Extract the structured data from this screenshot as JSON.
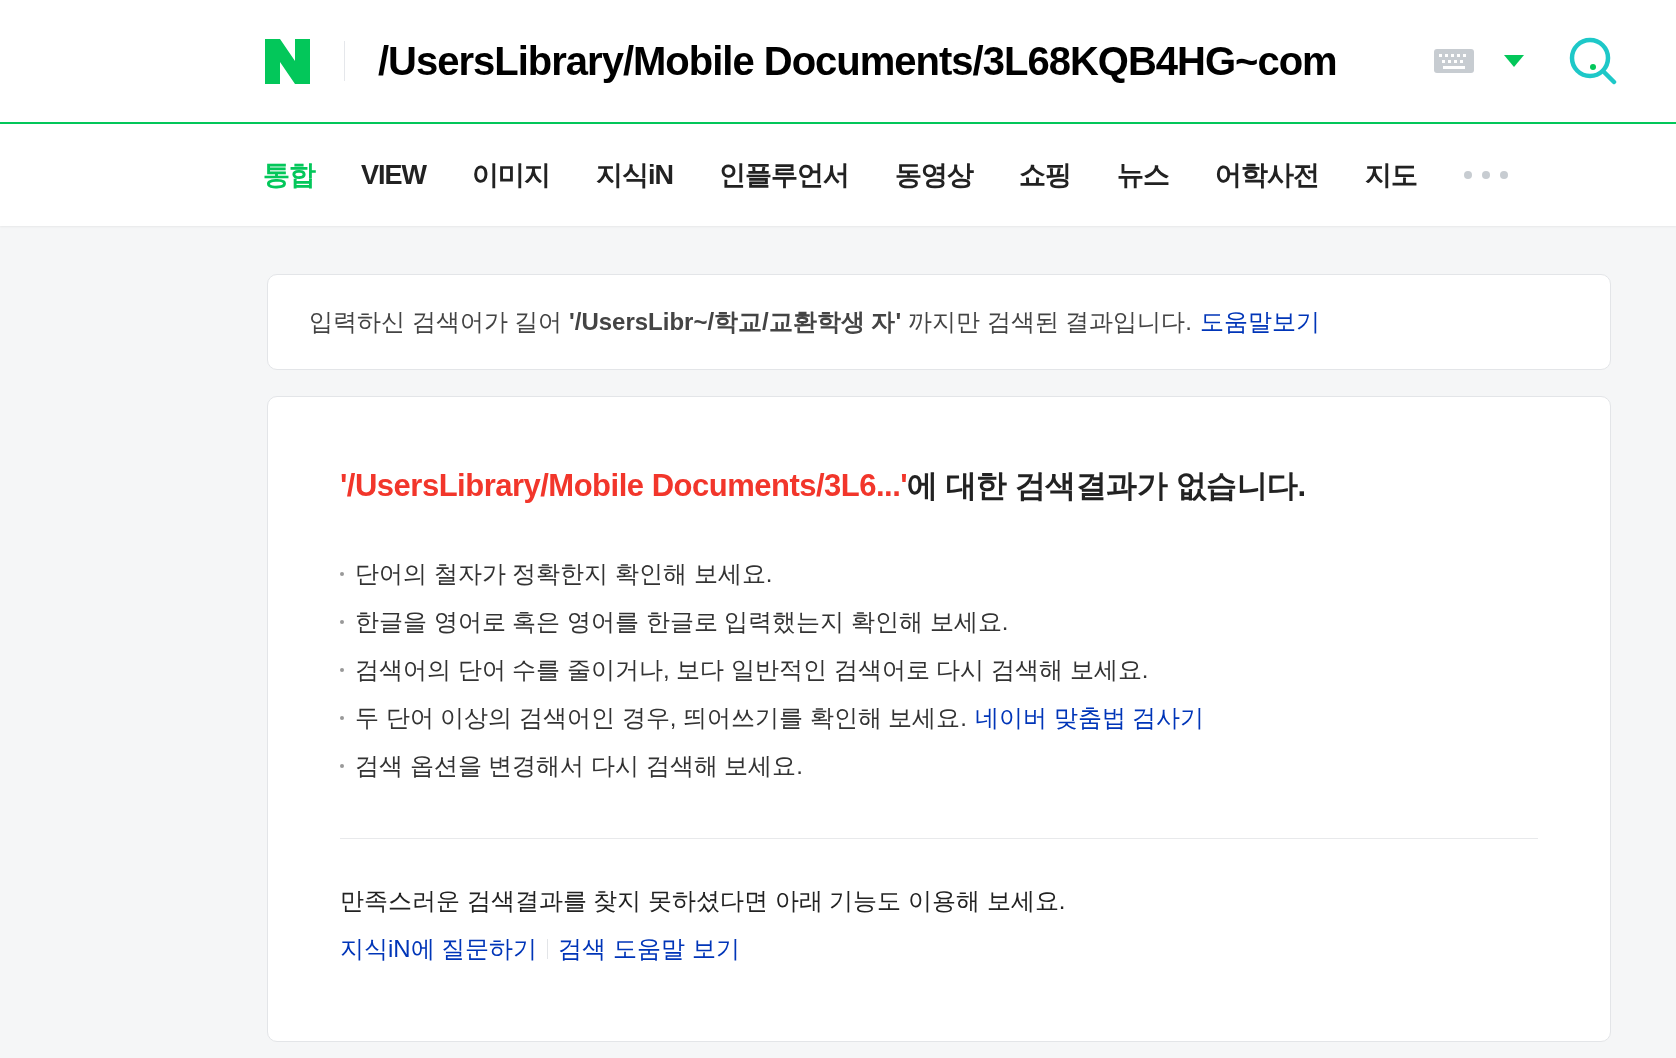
{
  "header": {
    "query": "/UsersLibrary/Mobile Documents/3L68KQB4HG~com"
  },
  "tabs": [
    {
      "label": "통합",
      "selected": true
    },
    {
      "label": "VIEW",
      "selected": false
    },
    {
      "label": "이미지",
      "selected": false
    },
    {
      "label": "지식iN",
      "selected": false
    },
    {
      "label": "인플루언서",
      "selected": false
    },
    {
      "label": "동영상",
      "selected": false
    },
    {
      "label": "쇼핑",
      "selected": false
    },
    {
      "label": "뉴스",
      "selected": false
    },
    {
      "label": "어학사전",
      "selected": false
    },
    {
      "label": "지도",
      "selected": false
    }
  ],
  "notice": {
    "text": "입력하신 검색어가 길어 **'/UsersLibr~/학교/교환학생 자'** 까지만 검색된 결과입니다.",
    "link": "도움말보기"
  },
  "result": {
    "query": "'/UsersLibrary/Mobile Documents/3L6...'",
    "heading": "에 대한 검색결과가 없습니다.",
    "tips": [
      {
        "text": "단어의 철자가 정확한지 확인해 보세요."
      },
      {
        "text": "한글을 영어로 혹은 영어를 한글로 입력했는지 확인해 보세요."
      },
      {
        "text": "검색어의 단어 수를 줄이거나, 보다 일반적인 검색어로 다시 검색해 보세요."
      },
      {
        "text": "두 단어 이상의 검색어인 경우, 띄어쓰기를 확인해 보세요.",
        "link": "네이버 맞춤법 검사기"
      },
      {
        "text": "검색 옵션을 변경해서 다시 검색해 보세요."
      }
    ],
    "footer_text": "만족스러운 검색결과를 찾지 못하셨다면 아래 기능도 이용해 보세요.",
    "footer_links": [
      "지식iN에 질문하기",
      "검색 도움말 보기"
    ]
  }
}
